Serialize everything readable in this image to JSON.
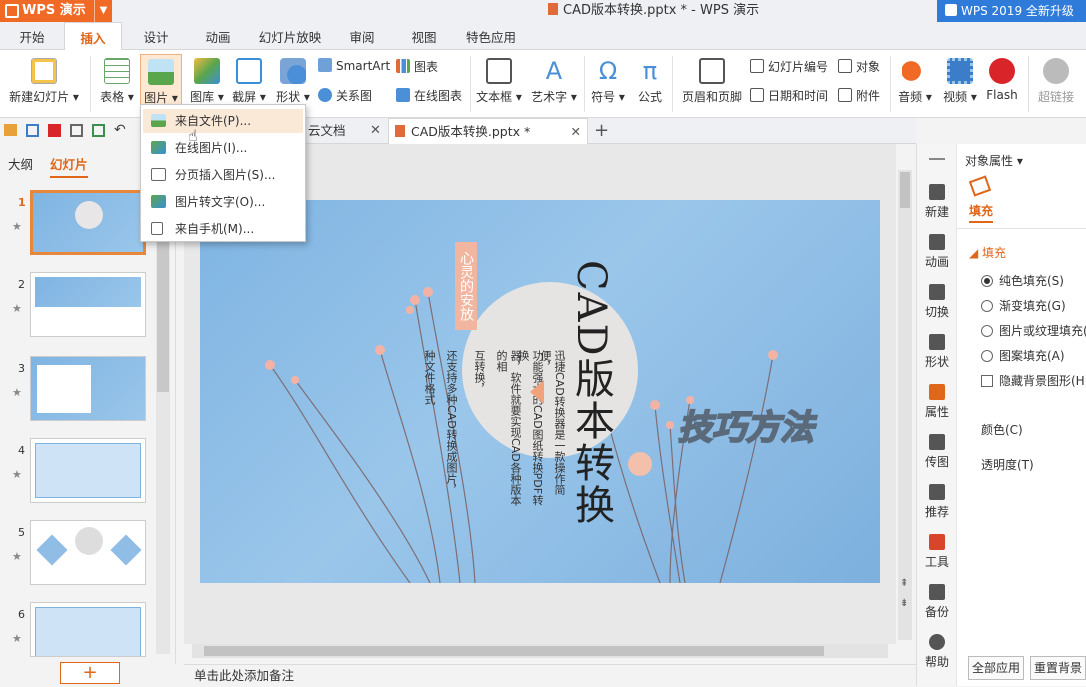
{
  "app": {
    "name": "WPS 演示",
    "title": "CAD版本转换.pptx * - WPS 演示",
    "upgrade": "WPS 2019 全新升级"
  },
  "tabs": [
    "开始",
    "插入",
    "设计",
    "动画",
    "幻灯片放映",
    "审阅",
    "视图",
    "特色应用"
  ],
  "active_tab": "插入",
  "ribbon": {
    "new_slide": "新建幻灯片",
    "table": "表格",
    "picture": "图片",
    "gallery": "图库",
    "screenshot": "截屏",
    "shapes": "形状",
    "smartart": "SmartArt",
    "relation": "关系图",
    "chart": "图表",
    "online_chart": "在线图表",
    "textbox": "文本框",
    "wordart": "艺术字",
    "symbol": "符号",
    "formula": "公式",
    "header_footer": "页眉和页脚",
    "slide_number": "幻灯片编号",
    "datetime": "日期和时间",
    "object": "对象",
    "attachment": "附件",
    "audio": "音频",
    "video": "视频",
    "flash": "Flash",
    "hyperlink": "超链接"
  },
  "picture_menu": [
    "来自文件(P)...",
    "在线图片(I)...",
    "分页插入图片(S)...",
    "图片转文字(O)...",
    "来自手机(M)..."
  ],
  "doc_tabs": {
    "cloud": "云文档",
    "current": "CAD版本转换.pptx *",
    "add": "+"
  },
  "left_panel": {
    "outline": "大纲",
    "slides": "幻灯片",
    "numbers": [
      "1",
      "2",
      "3",
      "4",
      "5",
      "6"
    ],
    "add": "+"
  },
  "slide": {
    "vertical_title": "CAD版本转换",
    "badge": "心灵的安放",
    "wordart": "技巧方法",
    "col1": "迅捷CAD转换器是一款操作简便，",
    "col2": "功能强大的CAD图纸转换PDF转换",
    "col3": "器，软件就要实现CAD各种版本的相",
    "col4": "互转换，",
    "col5": "还支持多种CAD转换成图片，",
    "col6": "种文件格式"
  },
  "notes": "单击此处添加备注",
  "sidebar": [
    "新建",
    "动画",
    "切换",
    "形状",
    "属性",
    "传图",
    "推荐",
    "工具",
    "备份",
    "帮助"
  ],
  "props": {
    "header": "对象属性",
    "tab": "填充",
    "section": "填充",
    "options": [
      "纯色填充(S)",
      "渐变填充(G)",
      "图片或纹理填充(",
      "图案填充(A)"
    ],
    "hide_bg": "隐藏背景图形(H)",
    "color": "颜色(C)",
    "transparency": "透明度(T)",
    "apply_all": "全部应用",
    "reset_bg": "重置背景"
  },
  "colors": {
    "accent": "#e0661a",
    "wps_orange": "#f06a25",
    "upgrade_blue": "#2f7bd9",
    "slide_blue": "#8fbde6"
  }
}
